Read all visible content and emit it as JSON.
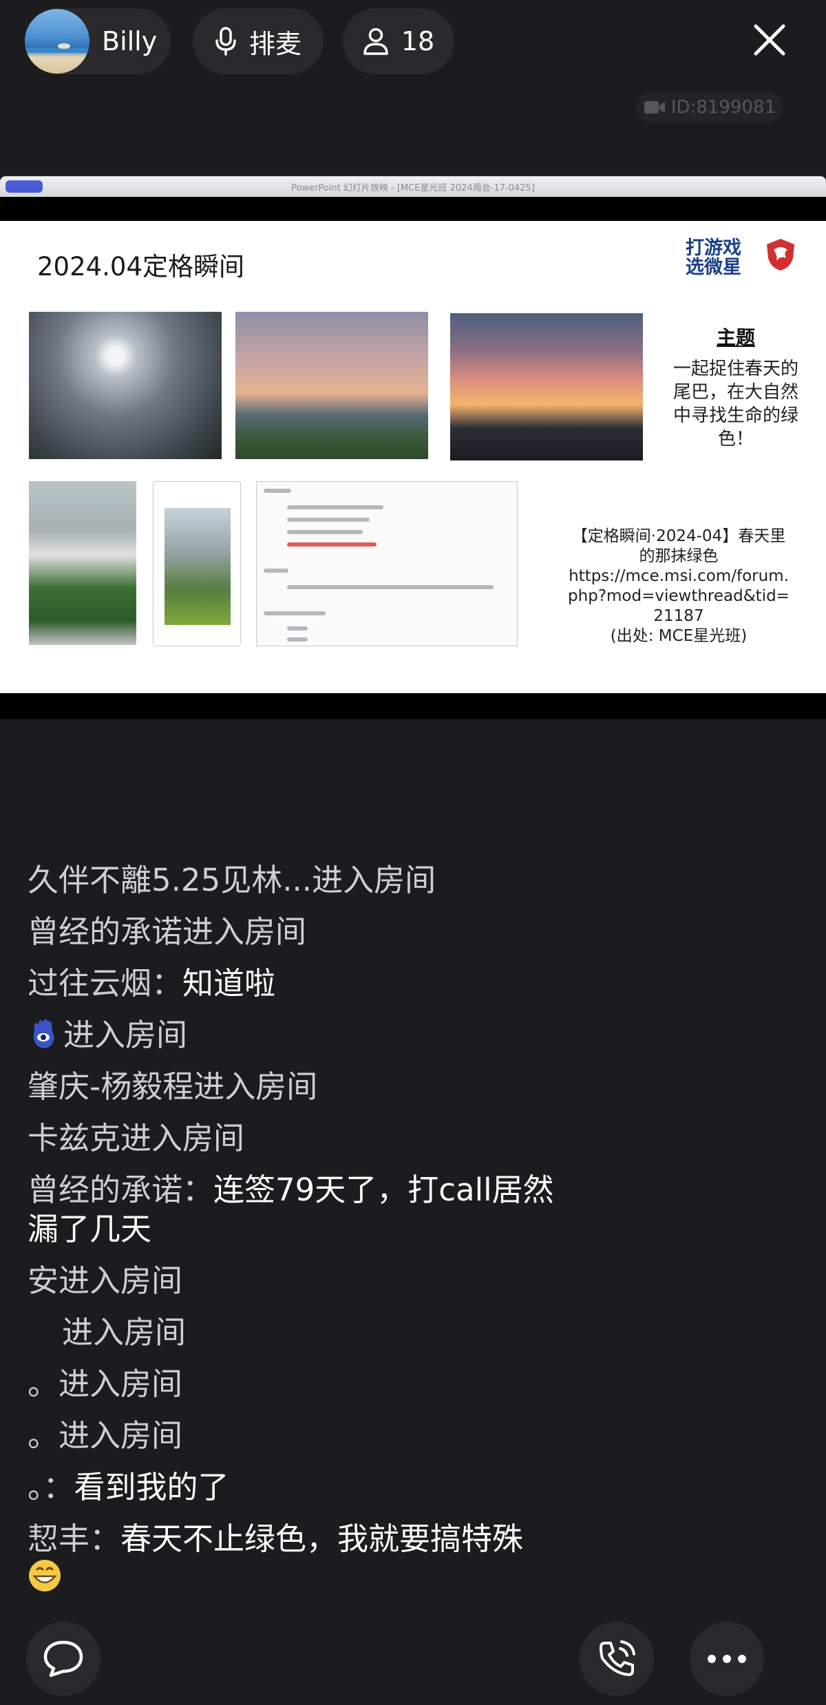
{
  "header": {
    "user_name": "Billy",
    "mic_label": "排麦",
    "audience_count": "18",
    "room_id": "ID:8199081"
  },
  "slide": {
    "window_title": "PowerPoint 幻灯片放映 - [MCE星光班 2024周会-17-0425]",
    "title": "2024.04定格瞬间",
    "brand_line1": "打游戏",
    "brand_line2": "选微星",
    "theme_heading": "主题",
    "theme_text": [
      "一起捉住春天的",
      "尾巴，在大自然",
      "中寻找生命的绿",
      "色！"
    ],
    "link_lines": [
      "【定格瞬间·2024-04】春天里",
      "的那抹绿色",
      "https://mce.msi.com/forum.",
      "php?mod=viewthread&tid=",
      "21187",
      "(出处: MCE星光班)"
    ]
  },
  "chat": {
    "messages": [
      {
        "user": "久伴不離5.25见林...",
        "text": "进入房间"
      },
      {
        "user": "曾经的承诺",
        "text": "进入房间"
      },
      {
        "user": "过往云烟：",
        "text": "知道啦"
      },
      {
        "user": "",
        "text": "进入房间"
      },
      {
        "user": "肇庆-杨毅程",
        "text": "进入房间"
      },
      {
        "user": "卡兹克",
        "text": "进入房间"
      },
      {
        "user": "曾经的承诺：",
        "text": "连签79天了，打call居然",
        "text2": "漏了几天"
      },
      {
        "user": "安",
        "text": "进入房间"
      },
      {
        "user": "",
        "text": "进入房间"
      },
      {
        "user": "。",
        "text": "进入房间"
      },
      {
        "user": "。",
        "text": "进入房间"
      },
      {
        "user": "。：",
        "text": "看到我的了"
      },
      {
        "user": "恝丰：",
        "text": "春天不止绿色，我就要搞特殊"
      }
    ]
  },
  "icons": {
    "mic": "microphone-icon",
    "person": "person-icon",
    "close": "close-icon",
    "video": "video-camera-icon",
    "comment": "comment-bubble-icon",
    "call": "phone-call-icon",
    "more": "more-dots-icon"
  }
}
